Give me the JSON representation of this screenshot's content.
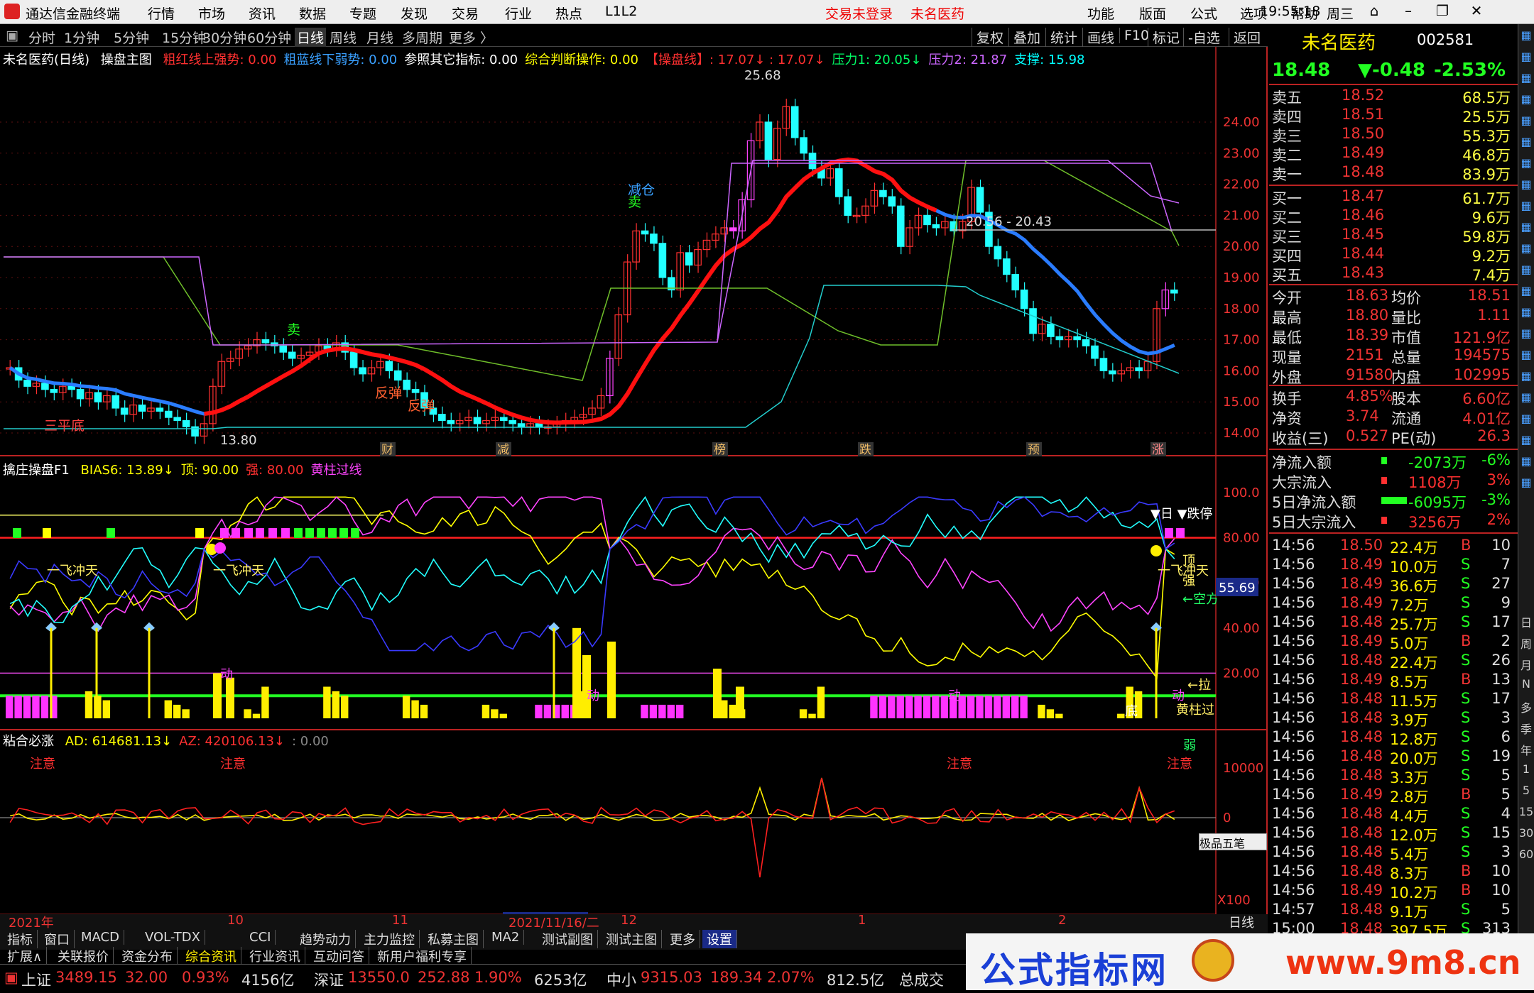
{
  "menubar": {
    "app_title": "通达信金融终端",
    "items": [
      "行情",
      "市场",
      "资讯",
      "数据",
      "专题",
      "发现",
      "交易",
      "行业",
      "热点",
      "L1L2"
    ],
    "login_status": "交易未登录",
    "stock_title": "未名医药",
    "right_items": [
      "功能",
      "版面",
      "公式",
      "选项",
      "帮助"
    ],
    "clock": "19:55:18",
    "weekday": "周三"
  },
  "periodbar": {
    "periods": [
      "分时",
      "1分钟",
      "5分钟",
      "15分钟",
      "30分钟",
      "60分钟",
      "日线",
      "周线",
      "月线",
      "多周期",
      "更多 〉"
    ],
    "active": "日线",
    "tools": [
      "复权",
      "叠加",
      "统计",
      "画线",
      "F10",
      "标记",
      "-自选",
      "返回"
    ]
  },
  "main_chart": {
    "title": "未名医药(日线)",
    "indicator": "操盘主图",
    "params": [
      {
        "label": "粗红线上强势: 0.00",
        "color": "#ff3030"
      },
      {
        "label": "粗蓝线下弱势: 0.00",
        "color": "#3aa0ff"
      },
      {
        "label": "参照其它指标: 0.00",
        "color": "#ffffff"
      },
      {
        "label": "综合判断操作: 0.00",
        "color": "#ffff00"
      },
      {
        "label": "【操盘线】: 17.07↓ : 17.07↓",
        "color": "#ff3030"
      },
      {
        "label": "压力1: 20.05↓",
        "color": "#00ff66"
      },
      {
        "label": "压力2: 21.87",
        "color": "#cc66ff"
      },
      {
        "label": "支撑: 15.98",
        "color": "#00ffff"
      }
    ],
    "y_ticks": [
      "24.00",
      "23.00",
      "22.00",
      "21.00",
      "20.00",
      "19.00",
      "18.00",
      "17.00",
      "16.00",
      "15.00",
      "14.00"
    ],
    "high_label": "25.68",
    "low_label": "13.80",
    "range_label": "20.56 - 20.43",
    "annotations": [
      {
        "text": "三平底",
        "color": "#ff4040"
      },
      {
        "text": "卖",
        "color": "#22ff22"
      },
      {
        "text": "减仓",
        "color": "#3aa0ff"
      },
      {
        "text": "卖",
        "color": "#22ff22"
      },
      {
        "text": "反弹",
        "color": "#ff6030"
      },
      {
        "text": "反弹",
        "color": "#ff6030"
      }
    ],
    "event_markers": [
      "财",
      "减",
      "榜",
      "跌",
      "预",
      "涨"
    ]
  },
  "indicator1": {
    "title": "擒庄操盘F1",
    "params": [
      {
        "label": "BIAS6: 13.89↓",
        "color": "#ffff00"
      },
      {
        "label": "顶: 90.00",
        "color": "#ffff00"
      },
      {
        "label": "强: 80.00",
        "color": "#ff3030"
      },
      {
        "label": "黄柱过线",
        "color": "#ff44ff"
      }
    ],
    "y_ticks": [
      "100.0",
      "80.00",
      "60.00",
      "40.00",
      "20.00"
    ],
    "current_value": "55.69",
    "labels": [
      "一飞冲天",
      "一飞冲天",
      "一飞冲天",
      "动",
      "动",
      "动",
      "动",
      "底",
      "注意",
      "注意",
      "注意",
      "注意",
      "顶",
      "强",
      "←空方",
      "←拉",
      "黄柱过",
      "弱",
      "▼日 ▼跌停"
    ]
  },
  "indicator2": {
    "title": "粘合必涨",
    "params": [
      {
        "label": "AD: 614681.13↓",
        "color": "#ffff00"
      },
      {
        "label": "AZ: 420106.13↓",
        "color": "#ff3030"
      },
      {
        "label": ": 0.00",
        "color": "#888888"
      }
    ],
    "y_ticks": [
      "10000",
      "0"
    ],
    "scale": "X100",
    "ime_label": "极品五笔"
  },
  "time_axis": {
    "labels": [
      "2021年",
      "10",
      "11",
      "2021/11/16/二",
      "12",
      "1",
      "2"
    ],
    "period": "日线"
  },
  "bottom_tabs": {
    "row1": [
      "指标",
      "窗口",
      "MACD",
      "VOL-TDX",
      "CCI",
      "趋势动力",
      "主力监控",
      "私募主图",
      "MA2",
      "测试副图",
      "测试主图",
      "更多",
      "设置"
    ],
    "row2": [
      "扩展∧",
      "关联报价",
      "资金分布",
      "综合资讯",
      "行业资讯",
      "互动问答",
      "新用户福利专享"
    ]
  },
  "quote": {
    "name": "未名医药",
    "code": "002581",
    "price": "18.48",
    "change": "▼-0.48",
    "pct": "-2.53%",
    "asks": [
      {
        "label": "卖五",
        "price": "18.52",
        "vol": "68.5万"
      },
      {
        "label": "卖四",
        "price": "18.51",
        "vol": "25.5万"
      },
      {
        "label": "卖三",
        "price": "18.50",
        "vol": "55.3万"
      },
      {
        "label": "卖二",
        "price": "18.49",
        "vol": "46.8万"
      },
      {
        "label": "卖一",
        "price": "18.48",
        "vol": "83.9万"
      }
    ],
    "bids": [
      {
        "label": "买一",
        "price": "18.47",
        "vol": "61.7万"
      },
      {
        "label": "买二",
        "price": "18.46",
        "vol": "9.6万"
      },
      {
        "label": "买三",
        "price": "18.45",
        "vol": "59.8万"
      },
      {
        "label": "买四",
        "price": "18.44",
        "vol": "9.2万"
      },
      {
        "label": "买五",
        "price": "18.43",
        "vol": "7.4万"
      }
    ],
    "stats": [
      {
        "l1": "今开",
        "v1": "18.63",
        "l2": "均价",
        "v2": "18.51"
      },
      {
        "l1": "最高",
        "v1": "18.80",
        "l2": "量比",
        "v2": "1.11"
      },
      {
        "l1": "最低",
        "v1": "18.39",
        "l2": "市值",
        "v2": "121.9亿"
      },
      {
        "l1": "现量",
        "v1": "2151",
        "l2": "总量",
        "v2": "194575"
      },
      {
        "l1": "外盘",
        "v1": "91580",
        "l2": "内盘",
        "v2": "102995"
      }
    ],
    "finance": [
      {
        "l1": "换手",
        "v1": "4.85%",
        "l2": "股本",
        "v2": "6.60亿"
      },
      {
        "l1": "净资",
        "v1": "3.74",
        "l2": "流通",
        "v2": "4.01亿"
      },
      {
        "l1": "收益(三)",
        "v1": "0.527",
        "l2": "PE(动)",
        "v2": "26.3"
      }
    ],
    "flows": [
      {
        "label": "净流入额",
        "value": "-2073万",
        "pct": "-6%",
        "color": "#22ff22"
      },
      {
        "label": "大宗流入",
        "value": "1108万",
        "pct": "3%",
        "color": "#ff3030"
      },
      {
        "label": "5日净流入额",
        "value": "-6095万",
        "pct": "-3%",
        "color": "#22ff22"
      },
      {
        "label": "5日大宗流入",
        "value": "3256万",
        "pct": "2%",
        "color": "#ff3030"
      }
    ],
    "ticks": [
      {
        "t": "14:56",
        "p": "18.50",
        "v": "22.4万",
        "d": "B",
        "n": "10"
      },
      {
        "t": "14:56",
        "p": "18.49",
        "v": "10.0万",
        "d": "S",
        "n": "7"
      },
      {
        "t": "14:56",
        "p": "18.49",
        "v": "36.6万",
        "d": "S",
        "n": "27"
      },
      {
        "t": "14:56",
        "p": "18.49",
        "v": "7.2万",
        "d": "S",
        "n": "9"
      },
      {
        "t": "14:56",
        "p": "18.48",
        "v": "25.7万",
        "d": "S",
        "n": "17"
      },
      {
        "t": "14:56",
        "p": "18.49",
        "v": "5.0万",
        "d": "B",
        "n": "2"
      },
      {
        "t": "14:56",
        "p": "18.48",
        "v": "22.4万",
        "d": "S",
        "n": "26"
      },
      {
        "t": "14:56",
        "p": "18.49",
        "v": "8.5万",
        "d": "B",
        "n": "13"
      },
      {
        "t": "14:56",
        "p": "18.48",
        "v": "11.5万",
        "d": "S",
        "n": "17"
      },
      {
        "t": "14:56",
        "p": "18.48",
        "v": "3.9万",
        "d": "S",
        "n": "3"
      },
      {
        "t": "14:56",
        "p": "18.48",
        "v": "12.8万",
        "d": "S",
        "n": "6"
      },
      {
        "t": "14:56",
        "p": "18.48",
        "v": "20.0万",
        "d": "S",
        "n": "19"
      },
      {
        "t": "14:56",
        "p": "18.48",
        "v": "3.3万",
        "d": "S",
        "n": "5"
      },
      {
        "t": "14:56",
        "p": "18.49",
        "v": "2.8万",
        "d": "B",
        "n": "5"
      },
      {
        "t": "14:56",
        "p": "18.48",
        "v": "4.4万",
        "d": "S",
        "n": "4"
      },
      {
        "t": "14:56",
        "p": "18.48",
        "v": "12.0万",
        "d": "S",
        "n": "15"
      },
      {
        "t": "14:56",
        "p": "18.48",
        "v": "5.4万",
        "d": "S",
        "n": "3"
      },
      {
        "t": "14:56",
        "p": "18.48",
        "v": "8.3万",
        "d": "B",
        "n": "10"
      },
      {
        "t": "14:56",
        "p": "18.49",
        "v": "10.2万",
        "d": "B",
        "n": "10"
      },
      {
        "t": "14:57",
        "p": "18.48",
        "v": "9.1万",
        "d": "S",
        "n": "5"
      },
      {
        "t": "15:00",
        "p": "18.48",
        "v": "397.5万",
        "d": "S",
        "n": "313"
      }
    ]
  },
  "sidebar": [
    "日",
    "周",
    "月",
    "N",
    "多",
    "季",
    "年",
    "1",
    "5",
    "15",
    "30",
    "60"
  ],
  "statusbar": {
    "items": [
      {
        "name": "上证",
        "price": "3489.15",
        "chg": "32.00",
        "pct": "0.93%",
        "amt": "4156亿"
      },
      {
        "name": "深证",
        "price": "13550.0",
        "chg": "252.88",
        "pct": "1.90%",
        "amt": "6253亿"
      },
      {
        "name": "中小",
        "price": "9315.03",
        "chg": "189.34",
        "pct": "2.07%",
        "amt": "812.5亿"
      }
    ],
    "tail": "总成交"
  },
  "banner": {
    "text": "公式指标网",
    "url": "www.9m8.cn"
  },
  "colors": {
    "up": "#ff3030",
    "down": "#22ffff",
    "ma_red": "#ff1010",
    "ma_blue": "#2a7cff"
  }
}
